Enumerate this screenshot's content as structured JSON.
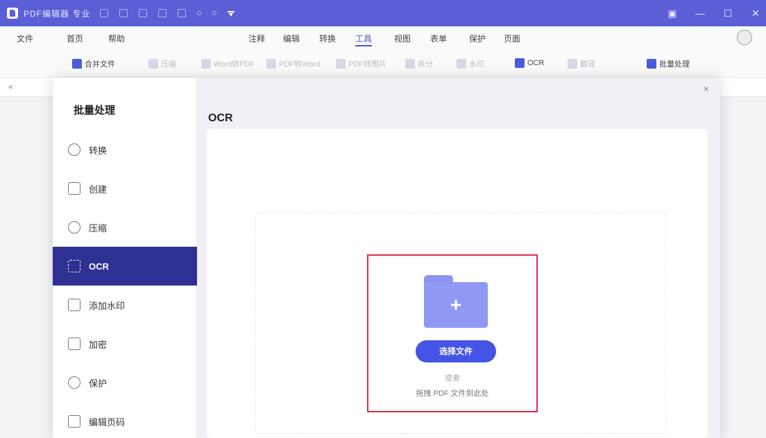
{
  "titlebar": {
    "app_name": "PDF编辑器 专业",
    "controls": {
      "skin": "▣",
      "minimize": "—",
      "maximize": "☐",
      "close": "✕"
    }
  },
  "menubar": {
    "items": [
      "文件",
      "首页",
      "帮助",
      "注释",
      "编辑",
      "转换",
      "工具",
      "视图",
      "表单",
      "保护",
      "页面"
    ],
    "active": "工具"
  },
  "toolbar": {
    "items": [
      {
        "label": "合并文件",
        "enabled": true
      },
      {
        "label": "压缩",
        "enabled": false
      },
      {
        "label": "Word转PDF",
        "enabled": false
      },
      {
        "label": "PDF转Word",
        "enabled": false
      },
      {
        "label": "PDF转图片",
        "enabled": false
      },
      {
        "label": "拆分",
        "enabled": false
      },
      {
        "label": "水印",
        "enabled": false
      },
      {
        "label": "OCR",
        "enabled": true
      },
      {
        "label": "翻译",
        "enabled": false
      },
      {
        "label": "批量处理",
        "enabled": true
      }
    ]
  },
  "ruler": {
    "arrow": "«"
  },
  "modal": {
    "sidebar_title": "批量处理",
    "sidebar_items": [
      "转换",
      "创建",
      "压缩",
      "OCR",
      "添加水印",
      "加密",
      "保护",
      "编辑页码"
    ],
    "active_item": "OCR",
    "panel_title": "OCR",
    "close": "×",
    "dropzone": {
      "button_label": "选择文件",
      "or_text": "或者",
      "drag_text": "拖拽 PDF 文件到此处"
    }
  },
  "colors": {
    "titlebar": "#5a5fd6",
    "accent": "#4553e6",
    "sidebar_active": "#2e3192",
    "highlight_border": "#e02a4a"
  }
}
